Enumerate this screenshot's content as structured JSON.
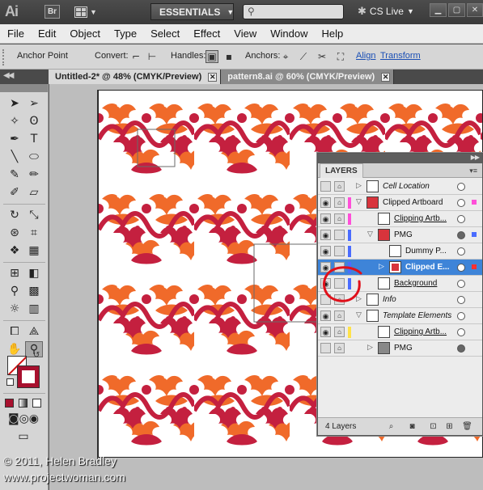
{
  "appbar": {
    "logo": "Ai",
    "bridge_label": "Br",
    "workspace_label": "ESSENTIALS",
    "cslive_label": "CS Live"
  },
  "menu": [
    "File",
    "Edit",
    "Object",
    "Type",
    "Select",
    "Effect",
    "View",
    "Window",
    "Help"
  ],
  "control_bar": {
    "anchor_point": "Anchor Point",
    "convert": "Convert:",
    "handles": "Handles:",
    "anchors": "Anchors:",
    "align_link": "Align",
    "transform_link": "Transform"
  },
  "tabs": [
    {
      "label": "Untitled-2* @ 48% (CMYK/Preview)",
      "active": true
    },
    {
      "label": "pattern8.ai @ 60% (CMYK/Preview)",
      "active": false
    }
  ],
  "layers_panel": {
    "title": "LAYERS",
    "rows": [
      {
        "name": "Cell Location",
        "style": "italic",
        "eye": false,
        "lock": true,
        "color": "",
        "expand": "right",
        "indent": 0,
        "target": "empty",
        "selected": false
      },
      {
        "name": "Clipped Artboard",
        "style": "normal",
        "eye": true,
        "lock": true,
        "color": "#ff4fd8",
        "expand": "down",
        "indent": 0,
        "target": "empty",
        "selected": false
      },
      {
        "name": "Clipping Artb...",
        "style": "underline",
        "eye": true,
        "lock": true,
        "color": "#ff4fd8",
        "expand": "",
        "indent": 1,
        "target": "empty",
        "selected": false
      },
      {
        "name": "PMG",
        "style": "normal",
        "eye": true,
        "lock": false,
        "color": "#4a6cff",
        "expand": "down",
        "indent": 1,
        "target": "filled",
        "selected": false
      },
      {
        "name": "Dummy P...",
        "style": "normal",
        "eye": true,
        "lock": false,
        "color": "#4a6cff",
        "expand": "",
        "indent": 2,
        "target": "empty",
        "selected": false
      },
      {
        "name": "Clipped E...",
        "style": "bold",
        "eye": true,
        "lock": false,
        "color": "#4a6cff",
        "expand": "right",
        "indent": 2,
        "target": "empty",
        "selected": true
      },
      {
        "name": "Background",
        "style": "underline",
        "eye": true,
        "lock": false,
        "color": "#4a6cff",
        "expand": "",
        "indent": 1,
        "target": "empty",
        "selected": false
      },
      {
        "name": "Info",
        "style": "italic",
        "eye": false,
        "lock": true,
        "color": "",
        "expand": "right",
        "indent": 0,
        "target": "empty",
        "selected": false
      },
      {
        "name": "Template Elements",
        "style": "italic",
        "eye": true,
        "lock": true,
        "color": "",
        "expand": "down",
        "indent": 0,
        "target": "empty",
        "selected": false
      },
      {
        "name": "Clipping Artb...",
        "style": "underline",
        "eye": true,
        "lock": true,
        "color": "#ffe24a",
        "expand": "",
        "indent": 1,
        "target": "empty",
        "selected": false
      },
      {
        "name": "PMG",
        "style": "normal",
        "eye": false,
        "lock": true,
        "color": "",
        "expand": "right",
        "indent": 1,
        "target": "filled",
        "selected": false
      }
    ],
    "footer_count": "4 Layers"
  },
  "watermark": {
    "line1": "© 2011, Helen Bradley",
    "line2": "www.projectwoman.com"
  },
  "colors": {
    "pattern_red": "#c4203f",
    "pattern_orange": "#f06a2a",
    "selection_blue": "#3e84d8",
    "annotation_red": "#e0101a"
  }
}
